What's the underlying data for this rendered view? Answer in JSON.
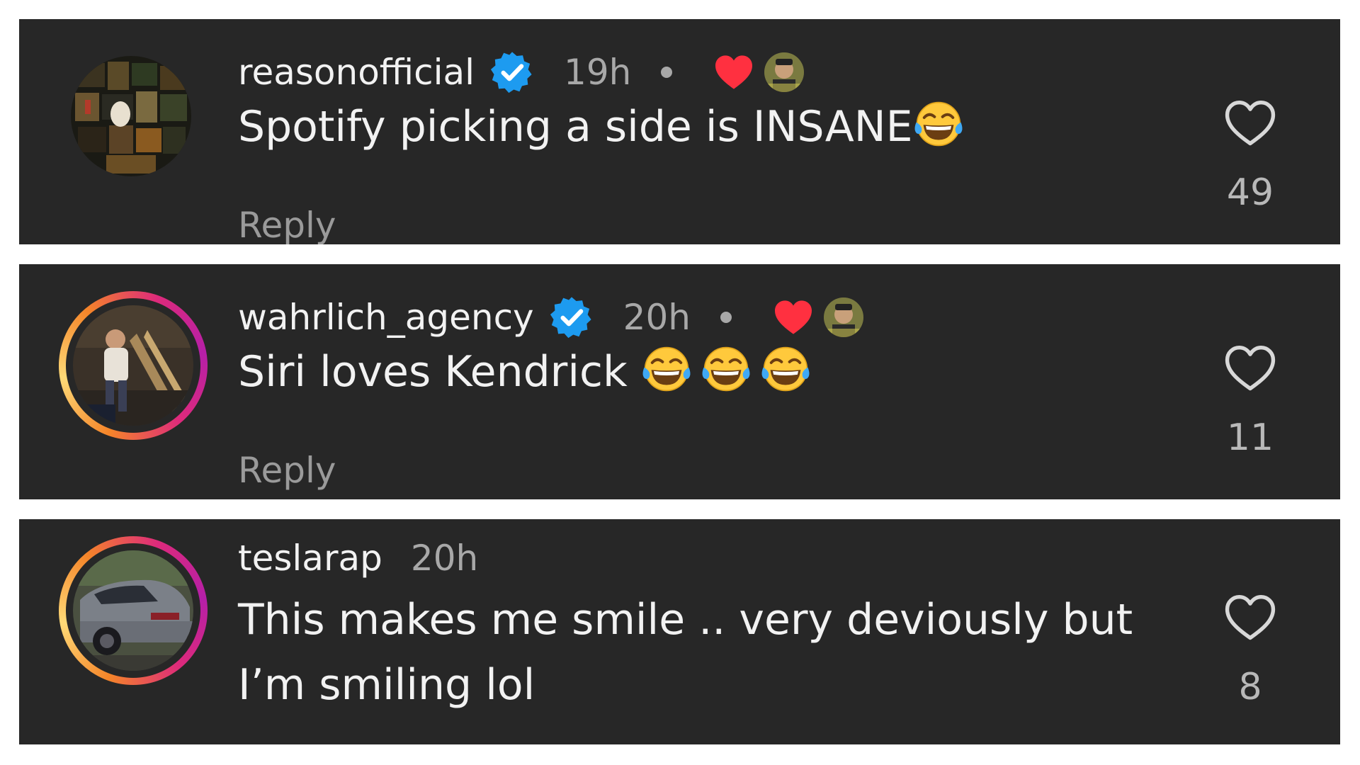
{
  "comments": [
    {
      "username": "reasonofficial",
      "verified": true,
      "time": "19h",
      "liked_by_creator": true,
      "text": "Spotify picking a side is INSANE",
      "emoji_count": 1,
      "reply_label": "Reply",
      "like_count": "49"
    },
    {
      "username": "wahrlich_agency",
      "verified": true,
      "time": "20h",
      "liked_by_creator": true,
      "text": "Siri loves Kendrick ",
      "emoji_count": 3,
      "reply_label": "Reply",
      "like_count": "11"
    },
    {
      "username": "teslarap",
      "verified": false,
      "time": "20h",
      "liked_by_creator": false,
      "text_line1": "This makes me smile .. very deviously but",
      "text_line2": "I’m smiling lol",
      "like_count": "8"
    }
  ],
  "icons": {
    "verified": "verified-badge-icon",
    "creator_heart": "heart-filled-icon",
    "like": "heart-outline-icon",
    "emoji": "tears-of-joy-emoji"
  },
  "colors": {
    "background": "#272727",
    "verified_blue": "#1d9bf0",
    "heart_red": "#ff3040",
    "text_primary": "#f2f2f2",
    "text_secondary": "#a8a8a8"
  }
}
